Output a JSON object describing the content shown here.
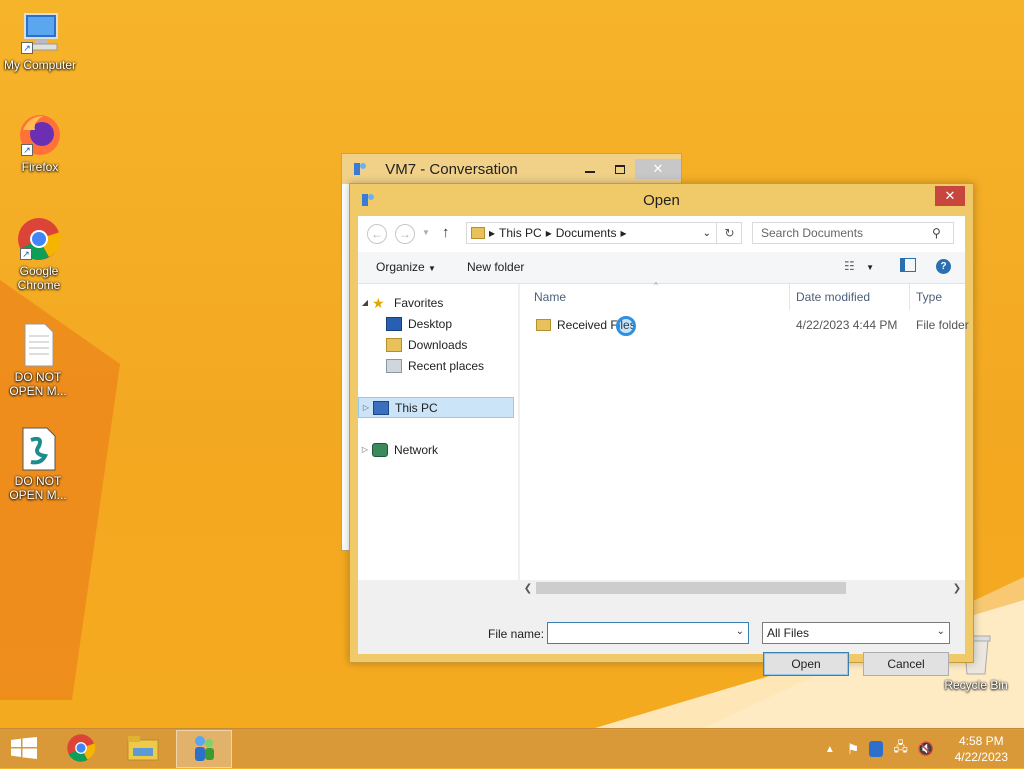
{
  "desktop": {
    "icons": [
      {
        "label": "My Computer"
      },
      {
        "label": "Firefox"
      },
      {
        "label": "Google Chrome"
      },
      {
        "label": "DO NOT OPEN M..."
      },
      {
        "label": "DO NOT OPEN M..."
      },
      {
        "label": "Recycle Bin"
      }
    ]
  },
  "background_window": {
    "title": "VM7 - Conversation"
  },
  "dialog": {
    "title": "Open",
    "close_glyph": "✕",
    "breadcrumb": [
      "This PC",
      "Documents"
    ],
    "search_placeholder": "Search Documents",
    "toolbar": {
      "organize": "Organize",
      "new_folder": "New folder"
    },
    "nav_tree": {
      "favorites": "Favorites",
      "desktop": "Desktop",
      "downloads": "Downloads",
      "recent_places": "Recent places",
      "this_pc": "This PC",
      "network": "Network"
    },
    "columns": {
      "name": "Name",
      "date_modified": "Date modified",
      "type": "Type"
    },
    "files": [
      {
        "name": "Received Files",
        "date_modified": "4/22/2023 4:44 PM",
        "type": "File folder"
      }
    ],
    "file_name_label": "File name:",
    "file_name_value": "",
    "filter": "All Files",
    "open_button": "Open",
    "cancel_button": "Cancel"
  },
  "taskbar": {
    "time": "4:58 PM",
    "date": "4/22/2023"
  },
  "colors": {
    "accent_selection": "#cce4f7",
    "close_red": "#c7463e",
    "window_frame": "#f0c968"
  }
}
